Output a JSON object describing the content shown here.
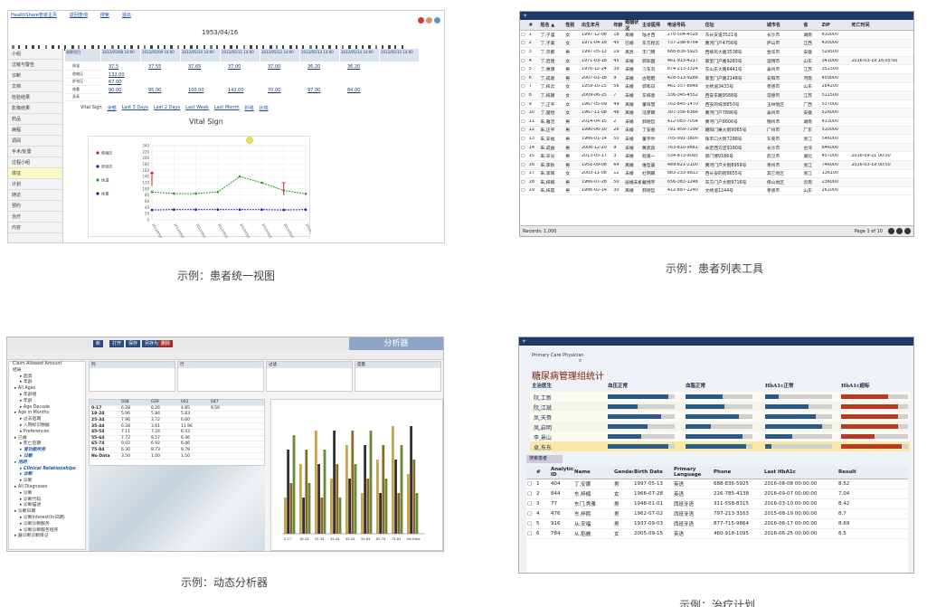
{
  "captions": {
    "p1": "示例：患者统一视图",
    "p2": "示例：患者列表工具",
    "p3": "示例：动态分析器",
    "p4": "示例：治疗计划"
  },
  "p1": {
    "top_links": [
      "HealthShare管道主页",
      "返回查询",
      "搜索",
      "退出"
    ],
    "date": "1953/04/16",
    "side_items": [
      "小组",
      "过敏与警告",
      "诊断",
      "文档",
      "检验结果",
      "影像结果",
      "药品",
      "病程",
      "调阅",
      "手术/处置",
      "过程小组",
      "体征",
      "计划",
      "随访",
      "预约",
      "治疗",
      "内容"
    ],
    "active_side": 11,
    "col_headers": [
      "观察项目",
      "2012/05/08 14:00",
      "2012/05/09 14:00",
      "2012/05/10 14:00",
      "2012/05/11 14:00",
      "2012/05/12 14:00",
      "2012/05/13 14:00",
      "2012/05/14 14:00",
      "2012/05/15 14:00"
    ],
    "row_labels": [
      "体温",
      "收缩压",
      "舒张压",
      "体重",
      "身高"
    ],
    "vals": [
      [
        "37.5",
        "37.55",
        "37.65",
        "37.00",
        "37.00",
        "36.20",
        "36.20"
      ],
      [
        "132.00",
        "",
        "",
        "",
        "",
        "",
        ""
      ],
      [
        "67.00",
        "",
        "",
        "",
        "",
        "",
        ""
      ],
      [
        "90.00",
        "95.00",
        "100.00",
        "142.00",
        "70.00",
        "97.00",
        "84.00"
      ]
    ],
    "vs_options": [
      "Vital Sign",
      "全部",
      "Last 3 Days",
      "Last 2 Days",
      "Last Week",
      "Last Month",
      "折线",
      "比较"
    ],
    "chart_title": "Vital Sign",
    "legend": [
      "收缩压",
      "舒张压",
      "体温",
      "体重"
    ]
  },
  "chart_data": {
    "type": "line",
    "title": "Vital Sign",
    "categories": [
      "2012/05/08",
      "2012/05/09",
      "2012/05/10",
      "2012/05/11",
      "2012/05/12",
      "2012/05/13",
      "2012/05/14",
      "2012/05/15"
    ],
    "ylim": [
      0,
      240
    ],
    "yticks": [
      0,
      20,
      40,
      60,
      80,
      100,
      120,
      140,
      160,
      180,
      200,
      220,
      240
    ],
    "series": [
      {
        "name": "体重",
        "color": "#2a9a2a",
        "values": [
          90,
          85,
          85,
          90,
          140,
          120,
          95,
          84
        ]
      },
      {
        "name": "舒张压",
        "color": "#1a1aaa",
        "values": [
          32,
          33,
          33,
          33,
          33,
          33,
          32,
          33
        ]
      },
      {
        "name": "收缩压",
        "color": "#cc2222",
        "values": [
          152,
          null,
          null,
          null,
          null,
          null,
          null,
          null
        ]
      }
    ]
  },
  "p2": {
    "tab": "+",
    "headers": [
      "#",
      "姓名 ▲",
      "性别",
      "出生年月",
      "年龄",
      "婚姻状况",
      "主诊医师",
      "电话号码",
      "住址",
      "城市名",
      "省",
      "ZIP",
      "死亡时间"
    ],
    "rows": [
      [
        "1",
        "丁,子庙",
        "女",
        "1997-12-08",
        "18",
        "离婚",
        "陆才西",
        "270-504-4528",
        "东长安道3521号",
        "长沙市",
        "湖南",
        "810000",
        ""
      ],
      [
        "2",
        "丁,子美",
        "女",
        "1971-04-16",
        "45",
        "已婚",
        "东方程云",
        "737-298-8764",
        "黄河门户4756号",
        "庐山市",
        "江西",
        "430000",
        ""
      ],
      [
        "3",
        "丁,京都",
        "男",
        "1997-05-13",
        "19",
        "离异",
        "丰门明",
        "688-836-5925",
        "西柳风大路3538号",
        "金华市",
        "安徽",
        "529500",
        ""
      ],
      [
        "4",
        "丁,启建",
        "女",
        "1971-03-18",
        "45",
        "未婚",
        "郭知国",
        "461-913-4217",
        "家宝门户路9283号",
        "淄博市",
        "山东",
        "341000",
        "2016-03-19 16:05:00"
      ],
      [
        "5",
        "丁,惠康",
        "男",
        "1976-12-24",
        "39",
        "未婚",
        "刁东刘",
        "874-213-3324",
        "东山东大路6441号",
        "泰州市",
        "江苏",
        "352300",
        ""
      ],
      [
        "6",
        "丁,成葛",
        "男",
        "2007-01-18",
        "9",
        "未婚",
        "古昭昭",
        "428-513-9288",
        "家宝门户路2148号",
        "安阳市",
        "河南",
        "450000",
        ""
      ],
      [
        "7",
        "丁,梓云",
        "女",
        "1959-10-25",
        "56",
        "未婚",
        "郭和日",
        "461-357-8848",
        "文绣道3433号",
        "孝感市",
        "山东",
        "284200",
        ""
      ],
      [
        "8",
        "丁,梓颖",
        "女",
        "2009-06-25",
        "7",
        "未婚",
        "东梓意",
        "336-345-4552",
        "西安东路9588号",
        "常德市",
        "江苏",
        "511500",
        ""
      ],
      [
        "9",
        "丁,正平",
        "女",
        "1967-05-09",
        "49",
        "离婚",
        "董梓慧",
        "762-845-1470",
        "西安的梓洞850号",
        "玉林地区",
        "广西",
        "537000",
        ""
      ],
      [
        "10",
        "丁,楚怡",
        "女",
        "1967-11-08",
        "48",
        "离婚",
        "冯梦颖",
        "307-356-6366",
        "黄河门户7896号",
        "泰州市",
        "安徽",
        "526000",
        ""
      ],
      [
        "11",
        "朱,雅洁",
        "男",
        "2014-04-15",
        "2",
        "未婚",
        "郝德哲",
        "412-083-7054",
        "黄河门户8606号",
        "锦州市",
        "湖南",
        "433000",
        ""
      ],
      [
        "12",
        "朱,正平",
        "男",
        "1990-06-30",
        "26",
        "未婚",
        "丁安春",
        "791-959-7299",
        "朝阳门果大街9065号",
        "广州市",
        "广东",
        "510000",
        ""
      ],
      [
        "13",
        "朱,安福",
        "男",
        "1966-01-14",
        "50",
        "未婚",
        "董宇乔",
        "705-991-3800",
        "珠市口大街7288号",
        "东莞市",
        "浙江",
        "546000",
        ""
      ],
      [
        "14",
        "朱,成益",
        "男",
        "2006-12-20",
        "9",
        "未婚",
        "黄武良",
        "763-810-9681",
        "永定西方店9180号",
        "长沙市",
        "台湾",
        "646000",
        ""
      ],
      [
        "15",
        "朱,辛光",
        "男",
        "2013-05-17",
        "3",
        "未婚",
        "程美一",
        "534-873-9093",
        "郭门博9186号",
        "武汉市",
        "湖北",
        "457000",
        "2016-09-21 00:50"
      ],
      [
        "16",
        "朱,李秋",
        "男",
        "1951-09-08",
        "64",
        "离婚",
        "维哲嘉",
        "489-821-2100",
        "黄河门户大街8959号",
        "青州市",
        "浙江",
        "746000",
        "2016-03-19 00:50"
      ],
      [
        "17",
        "朱,李辉",
        "女",
        "2003-11-08",
        "12",
        "未婚",
        "杜明朝",
        "883-233-9813",
        "西长安的街8655号",
        "其它地区",
        "浙江",
        "136100",
        ""
      ],
      [
        "18",
        "朱,梓楠",
        "男",
        "1966-07-28",
        "50",
        "层婚未婚",
        "戴博宇",
        "656-383-1248",
        "东方门户大街9716号",
        "保山地区",
        "云南",
        "236000",
        ""
      ],
      [
        "19",
        "朱,梓晨",
        "男",
        "1986-02-14",
        "30",
        "离婚",
        "郝德哲",
        "412-887-2240",
        "文绣道1244号",
        "孝感市",
        "山东",
        "261000",
        ""
      ]
    ],
    "records": "Records: 1,000",
    "page": "Page 1 of 10"
  },
  "p3": {
    "buttons": [
      "新",
      "打开",
      "保存",
      "另存为",
      "删除"
    ],
    "brand": "分析器",
    "tree": [
      "Claim Allowed Amount",
      "结局",
      "超高",
      "年龄",
      "All Ages",
      "年龄组",
      "年龄",
      "Age Decade",
      "Age in Months",
      "过去后期",
      "入院标识数据",
      "Preferences",
      "已婚",
      "死亡后期",
      "肾功能所用",
      "过敏",
      "用药",
      "Clinical Relationships",
      "诊断",
      "诊断",
      "All Diagnoses",
      "诊断",
      "诊断代码",
      "诊断描述",
      "诊断日期",
      "诊断Interest(In日期)",
      "诊断诊断服务",
      "诊断诊断服务程序",
      "器诊断诊断目记"
    ],
    "bold_tree": [
      14,
      15,
      16,
      17,
      18
    ],
    "col_head": [
      "",
      "038",
      "039",
      "042",
      "047"
    ],
    "rows": [
      [
        "0-17",
        "6.28",
        "6.26",
        "4.85",
        "9.56"
      ],
      [
        "18-24",
        "5.96",
        "5.84",
        "5.83",
        ""
      ],
      [
        "25-34",
        "7.96",
        "3.72",
        "6.60",
        ""
      ],
      [
        "35-44",
        "6.28",
        "3.61",
        "11.96",
        ""
      ],
      [
        "45-54",
        "7.11",
        "7.24",
        "6.43",
        ""
      ],
      [
        "55-64",
        "7.72",
        "8.57",
        "6.46",
        ""
      ],
      [
        "65-74",
        "9.02",
        "6.92",
        "6.46",
        ""
      ],
      [
        "75-84",
        "6.30",
        "8.73",
        "9.78",
        ""
      ],
      [
        "No Data",
        "3.50",
        "1.00",
        "1.50",
        ""
      ]
    ],
    "panes": [
      "列",
      "行",
      "过滤",
      "度量"
    ],
    "bar_groups": [
      "0-17",
      "18-24",
      "25-34",
      "35-44",
      "45-54",
      "55-64",
      "65-74",
      "75-84",
      "No Data"
    ]
  },
  "p4": {
    "physician": "Primary Care Physician",
    "title": "糖尿病管理组统计",
    "col_heads": [
      "主治医生",
      "血压正常",
      "血脂正常",
      "HbA1c正常",
      "HbA1c超标"
    ],
    "doctors": [
      {
        "name": "阮,工新",
        "a": 0.9,
        "b": 0.55,
        "c": 0.2,
        "d": 0.7
      },
      {
        "name": "阮,江斌",
        "a": 0.45,
        "b": 0.58,
        "c": 0.65,
        "d": 0.85
      },
      {
        "name": "凤,天哥",
        "a": 0.8,
        "b": 0.8,
        "c": 0.75,
        "d": 0.85
      },
      {
        "name": "凤,启明",
        "a": 0.6,
        "b": 0.38,
        "c": 0.85,
        "d": 0.85
      },
      {
        "name": "李,景山",
        "a": 0.5,
        "b": 0.85,
        "c": 0.4,
        "d": 0.5
      },
      {
        "name": "卓,东东",
        "a": 0.9,
        "b": 0.9,
        "c": 0.1,
        "d": 0.9
      }
    ],
    "tbl_headers": [
      "#",
      "Analytics ID",
      "Name",
      "Gender",
      "Birth Date",
      "Primary Language",
      "Phone",
      "Last HbA1c",
      "Result"
    ],
    "tbl_rows": [
      [
        "1",
        "404",
        "丁,安娜",
        "男",
        "1997-05-13",
        "英语",
        "688-836-5925",
        "2016-08-08 00:00:00",
        "8.52"
      ],
      [
        "2",
        "844",
        "东,梓楠",
        "女",
        "1966-07-28",
        "英语",
        "226-785-4138",
        "2016-09-07 00:00:00",
        "7.04"
      ],
      [
        "3",
        "77",
        "东门,秀雅",
        "男",
        "1948-01-01",
        "西班牙语",
        "311-558-8315",
        "2016-03-10 00:00:00",
        "8.42"
      ],
      [
        "4",
        "476",
        "东,梓熙",
        "男",
        "1962-07-02",
        "西班牙语",
        "797-213-3163",
        "2015-08-19 00:00:00",
        "8.7"
      ],
      [
        "5",
        "916",
        "从,安福",
        "男",
        "1937-09-03",
        "西班牙语",
        "877-715-9864",
        "2016-06-17 00:00:00",
        "8.69"
      ],
      [
        "6",
        "784",
        "从,稻麗",
        "女",
        "2005-09-15",
        "英语",
        "460-918-1095",
        "2016-06-25 00:00:00",
        "8.5"
      ]
    ]
  }
}
